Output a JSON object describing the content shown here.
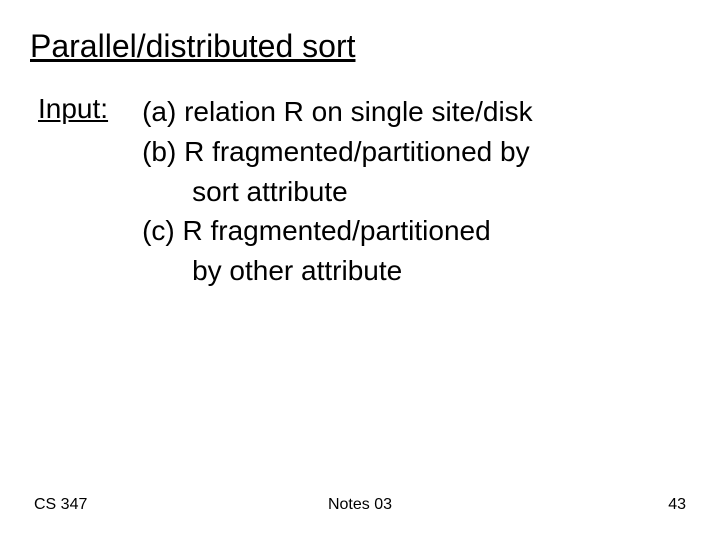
{
  "slide": {
    "title": "Parallel/distributed sort",
    "input_label": "Input:",
    "items": {
      "a": "(a) relation R on single site/disk",
      "b1": "(b) R fragmented/partitioned by",
      "b2": "sort attribute",
      "c1": "(c) R fragmented/partitioned",
      "c2": "by other attribute"
    }
  },
  "footer": {
    "left": "CS 347",
    "center": "Notes 03",
    "right": "43"
  }
}
